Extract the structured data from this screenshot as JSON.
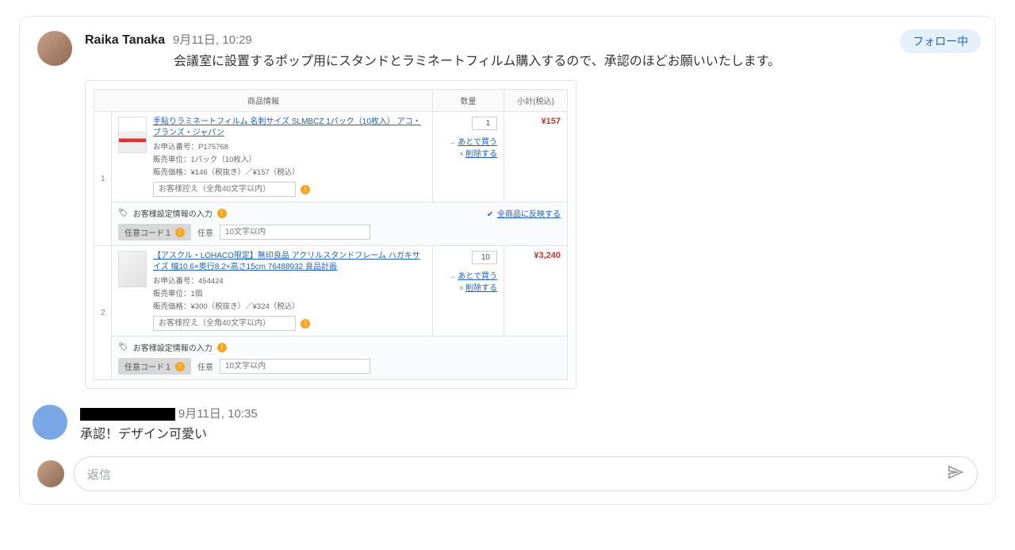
{
  "follow_badge": "フォロー中",
  "post": {
    "author": "Raika Tanaka",
    "timestamp": "9月11日, 10:29",
    "text": "会議室に設置するポップ用にスタンドとラミネートフィルム購入するので、承認のほどお願いいたします。"
  },
  "order": {
    "headers": {
      "info": "商品情報",
      "qty": "数量",
      "subtotal": "小計(税込)"
    },
    "note_placeholder": "お客様控え（全角40文字以内）",
    "settings_label": "お客様設定情報の入力",
    "reflect_all": "全商品に反映する",
    "code_chip": "任意コード１",
    "code_label": "任意",
    "code_placeholder": "10文字以内",
    "later_label": "あとで買う",
    "delete_label": "削除する",
    "items": [
      {
        "idx": "1",
        "name": "手貼りラミネートフィルム 名刺サイズ SLMBCZ 1パック（10枚入） アコ・ブランズ・ジャパン",
        "apply_no_label": "お申込番号：",
        "apply_no": "P175768",
        "unit_line": "販売単位：1パック（10枚入）",
        "price_line": "販売価格：¥146（税抜き）／¥157（税込）",
        "qty": "1",
        "subtotal": "¥157"
      },
      {
        "idx": "2",
        "name": "【アスクル・LOHACO限定】無印良品 アクリルスタンドフレーム ハガキサイズ 幅10.6×奥行8.2×高さ15cm 76488932 良品計画",
        "apply_no_label": "お申込番号：",
        "apply_no": "454424",
        "unit_line": "販売単位：1個",
        "price_line": "販売価格：¥300（税抜き）／¥324（税込）",
        "qty": "10",
        "subtotal": "¥3,240"
      }
    ]
  },
  "comment": {
    "timestamp": "9月11日, 10:35",
    "text": "承認！デザイン可愛い"
  },
  "reply_placeholder": "返信"
}
